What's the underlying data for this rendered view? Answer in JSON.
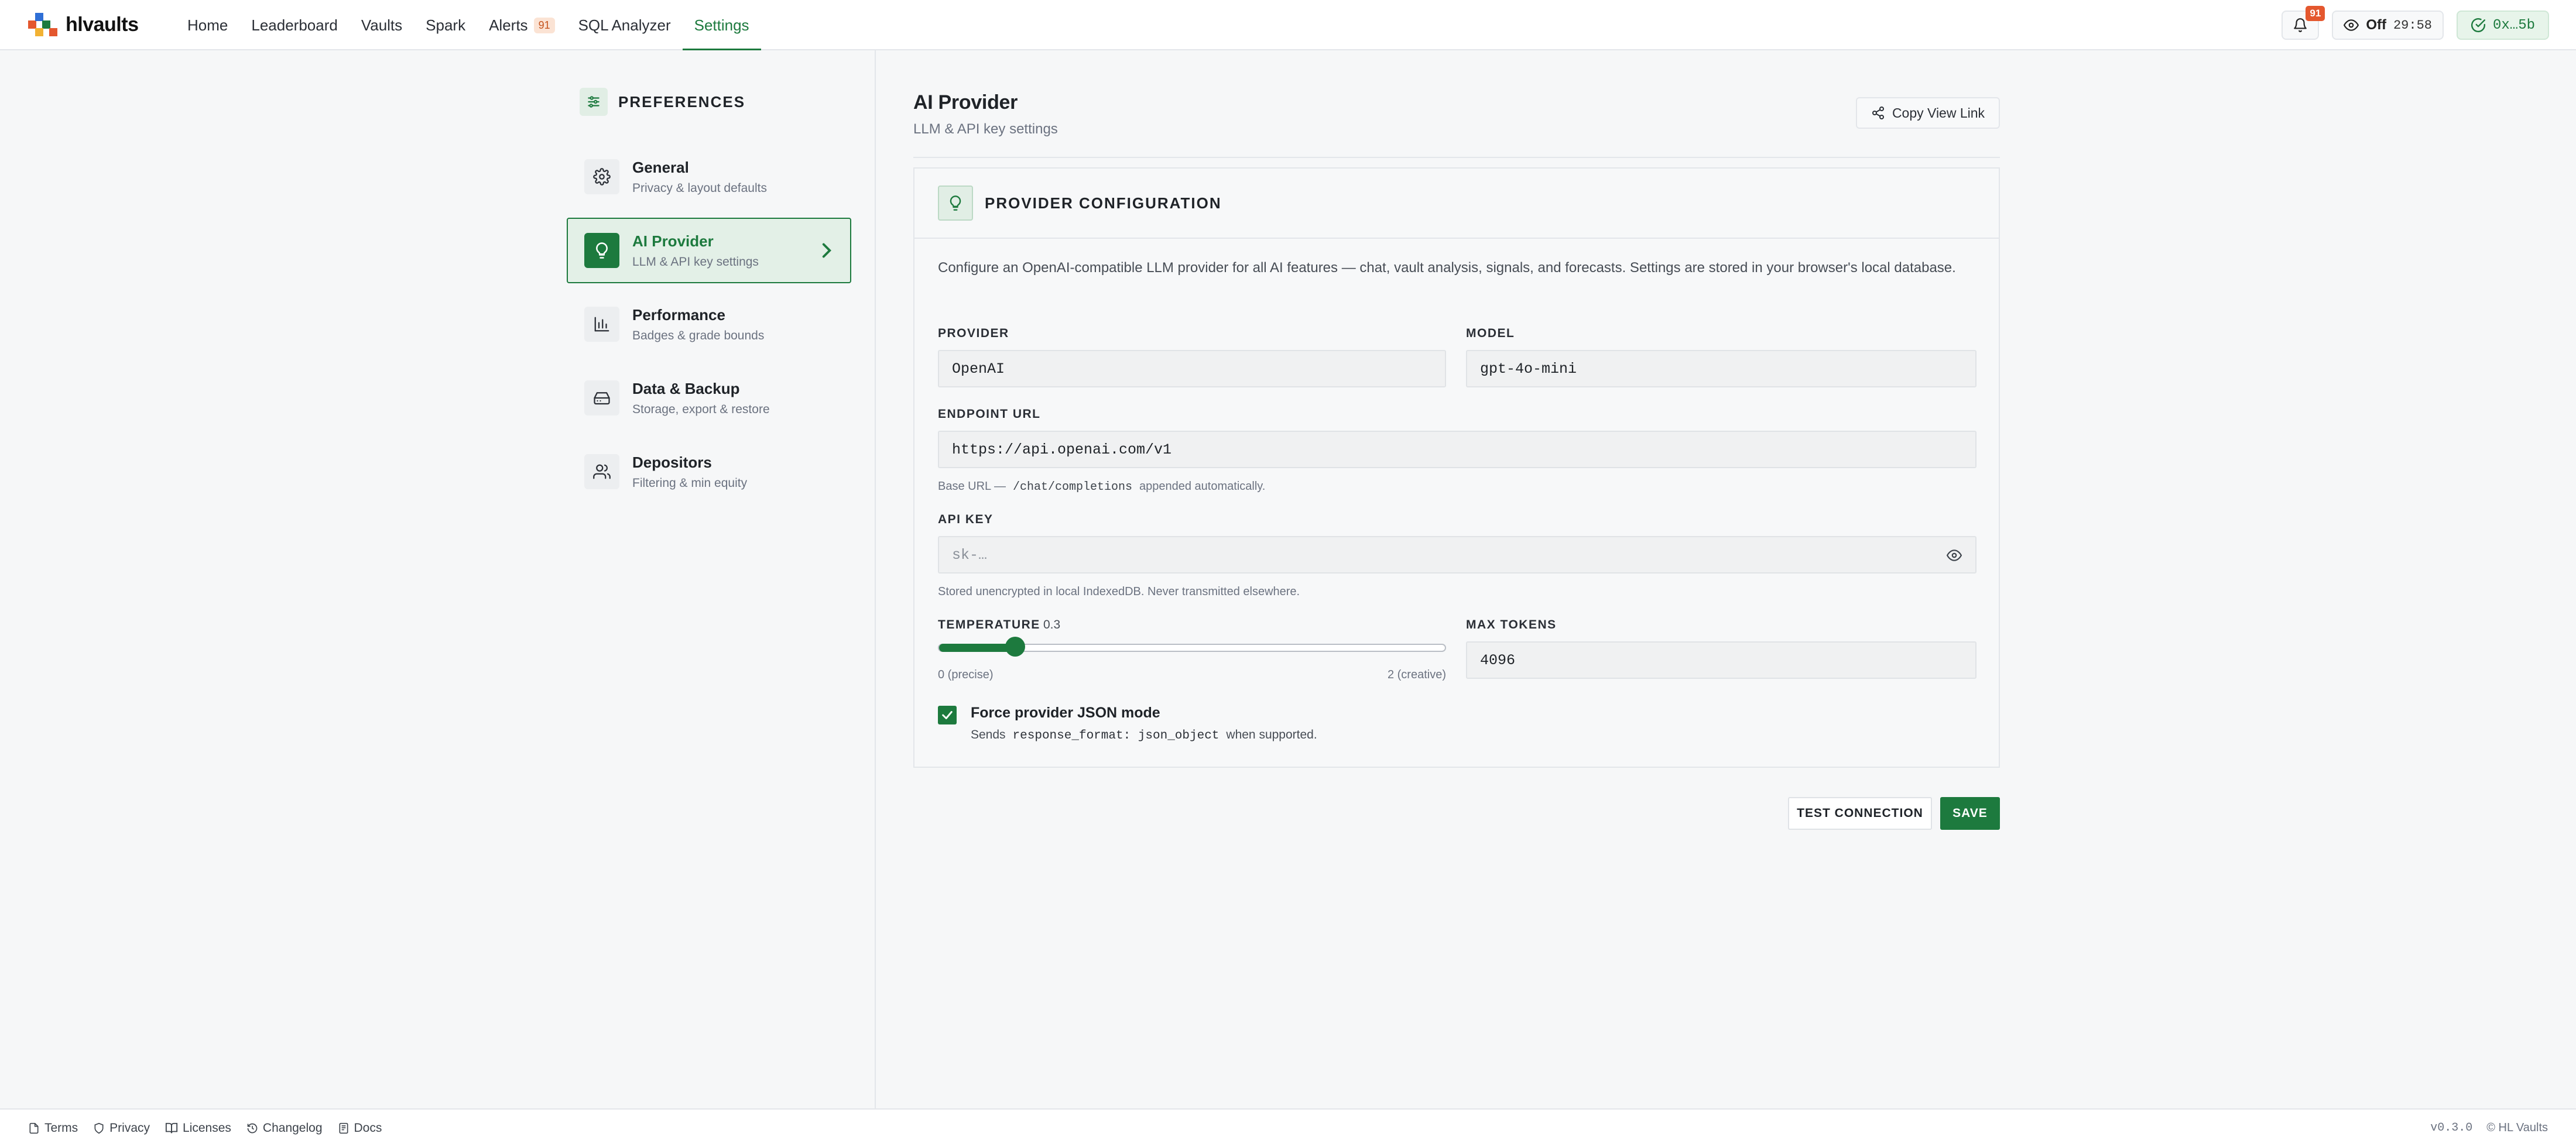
{
  "brand": {
    "name": "hlvaults",
    "colors": {
      "accent": "#1d7a3e",
      "alert": "#e4572e",
      "logo": [
        "#e4572e",
        "#2f6fd6",
        "#1d7a3e",
        "#f2b233"
      ]
    }
  },
  "nav": {
    "items": [
      {
        "label": "Home"
      },
      {
        "label": "Leaderboard"
      },
      {
        "label": "Vaults"
      },
      {
        "label": "Spark"
      },
      {
        "label": "Alerts",
        "badge": "91"
      },
      {
        "label": "SQL Analyzer"
      },
      {
        "label": "Settings",
        "active": true
      }
    ]
  },
  "header_right": {
    "notification_count": "91",
    "privacy_label": "Off",
    "privacy_timer": "29:58",
    "wallet": "0x…5b"
  },
  "sidebar": {
    "title": "PREFERENCES",
    "items": [
      {
        "title": "General",
        "subtitle": "Privacy & layout defaults",
        "icon": "gear-icon"
      },
      {
        "title": "AI Provider",
        "subtitle": "LLM & API key settings",
        "icon": "lightbulb-icon",
        "active": true
      },
      {
        "title": "Performance",
        "subtitle": "Badges & grade bounds",
        "icon": "bar-chart-icon"
      },
      {
        "title": "Data & Backup",
        "subtitle": "Storage, export & restore",
        "icon": "hard-drive-icon"
      },
      {
        "title": "Depositors",
        "subtitle": "Filtering & min equity",
        "icon": "users-icon"
      }
    ]
  },
  "main": {
    "title": "AI Provider",
    "subtitle": "LLM & API key settings",
    "copy_link_label": "Copy View Link",
    "card": {
      "title": "PROVIDER CONFIGURATION",
      "description": "Configure an OpenAI-compatible LLM provider for all AI features — chat, vault analysis, signals, and forecasts. Settings are stored in your browser's local database.",
      "provider": {
        "label": "PROVIDER",
        "value": "OpenAI"
      },
      "model": {
        "label": "MODEL",
        "value": "gpt-4o-mini"
      },
      "endpoint": {
        "label": "ENDPOINT URL",
        "value": "https://api.openai.com/v1",
        "hint_prefix": "Base URL —",
        "hint_code": "/chat/completions",
        "hint_suffix": "appended automatically."
      },
      "api_key": {
        "label": "API KEY",
        "placeholder": "sk-…",
        "hint": "Stored unencrypted in local IndexedDB. Never transmitted elsewhere."
      },
      "temperature": {
        "label": "TEMPERATURE",
        "value": "0.3",
        "value_num": 0.3,
        "min": 0,
        "max": 2,
        "min_label": "0 (precise)",
        "max_label": "2 (creative)"
      },
      "max_tokens": {
        "label": "MAX TOKENS",
        "value": "4096"
      },
      "json_mode": {
        "checked": true,
        "label": "Force provider JSON mode",
        "hint_prefix": "Sends",
        "hint_code": "response_format: json_object",
        "hint_suffix": "when supported."
      }
    },
    "buttons": {
      "test": "TEST CONNECTION",
      "save": "SAVE"
    }
  },
  "footer": {
    "links": [
      {
        "label": "Terms",
        "icon": "document-icon"
      },
      {
        "label": "Privacy",
        "icon": "shield-icon"
      },
      {
        "label": "Licenses",
        "icon": "book-icon"
      },
      {
        "label": "Changelog",
        "icon": "history-icon"
      },
      {
        "label": "Docs",
        "icon": "docs-icon"
      }
    ],
    "version": "v0.3.0",
    "copyright": "© HL Vaults"
  }
}
